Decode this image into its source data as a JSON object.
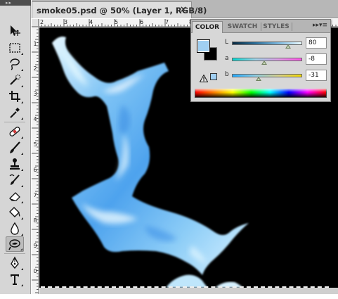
{
  "document": {
    "tab_title": "smoke05.psd @ 50% (Layer 1, RGB/8)",
    "close_glyph": "×"
  },
  "rulers": {
    "top_labels": [
      "2",
      "3",
      "4",
      "5",
      "6",
      "7",
      "8"
    ],
    "left_labels": [
      "1",
      "2",
      "3",
      "4",
      "5",
      "6",
      "7",
      "8",
      "9",
      "0"
    ]
  },
  "tools": [
    {
      "name": "move-tool-icon"
    },
    {
      "name": "rectangular-marquee-icon"
    },
    {
      "name": "lasso-tool-icon"
    },
    {
      "name": "quick-selection-icon"
    },
    {
      "name": "crop-tool-icon"
    },
    {
      "name": "eyedropper-icon"
    },
    {
      "name": "healing-brush-icon"
    },
    {
      "name": "brush-tool-icon"
    },
    {
      "name": "clone-stamp-icon"
    },
    {
      "name": "history-brush-icon"
    },
    {
      "name": "eraser-icon"
    },
    {
      "name": "paint-bucket-icon"
    },
    {
      "name": "blur-tool-icon"
    },
    {
      "name": "dodge-tool-icon"
    },
    {
      "name": "pen-tool-icon"
    },
    {
      "name": "type-tool-icon"
    }
  ],
  "selected_tool": "dodge-tool-icon",
  "color_panel": {
    "tabs": [
      "COLOR",
      "SWATCH",
      "STYLES"
    ],
    "active_tab": "COLOR",
    "collapse_glyph": "▸▸",
    "menu_glyph": "▾≡",
    "foreground_color": "#a0cff2",
    "background_color": "#000000",
    "sliders": [
      {
        "label": "L",
        "value": "80",
        "fraction": 0.8
      },
      {
        "label": "a",
        "value": "-8",
        "fraction": 0.46
      },
      {
        "label": "b",
        "value": "-31",
        "fraction": 0.38
      }
    ]
  },
  "colors": {
    "canvas": "#000000",
    "smoke_blue": "#5aa9ee",
    "smoke_light": "#d8f2ff",
    "toolbar": "#d6d6d6",
    "panel": "#d7d7d7"
  }
}
